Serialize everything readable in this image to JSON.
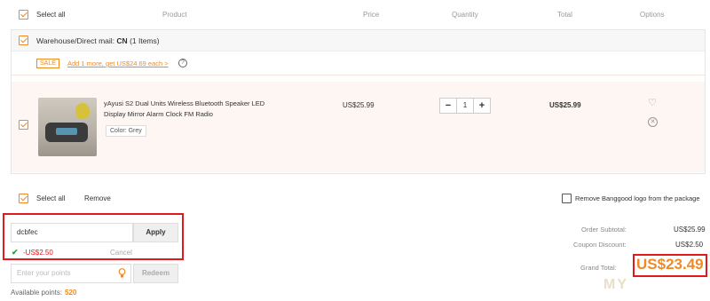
{
  "header": {
    "select_all": "Select all",
    "product": "Product",
    "price": "Price",
    "quantity": "Quantity",
    "total": "Total",
    "options": "Options"
  },
  "group": {
    "warehouse_label": "Warehouse/Direct mail:",
    "warehouse_code": "CN",
    "items_count": "(1 Items)",
    "sale_badge": "SALE",
    "promo_text": "Add 1 more, get US$24.69 each >",
    "help_icon": "?"
  },
  "item": {
    "title": "yAyusi S2 Dual Units Wireless Bluetooth Speaker LED Display Mirror Alarm Clock FM Radio",
    "color": "Color: Grey",
    "price": "US$25.99",
    "quantity": "1",
    "minus": "−",
    "plus": "+",
    "total": "US$25.99",
    "icons": {
      "wishlist": "heart-icon",
      "remove": "close-icon"
    }
  },
  "bottom_bar": {
    "select_all": "Select all",
    "remove": "Remove",
    "remove_logo": "Remove Banggood logo from the package"
  },
  "coupon": {
    "code": "dcbfec",
    "apply": "Apply",
    "applied_amount": "-US$2.50",
    "cancel": "Cancel"
  },
  "points": {
    "placeholder": "Enter your points",
    "redeem": "Redeem",
    "available_label": "Available points:",
    "available_value": "520"
  },
  "summary": {
    "subtotal_label": "Order Subtotal:",
    "subtotal_value": "US$25.99",
    "coupon_label": "Coupon Discount:",
    "coupon_value": "US$2.50",
    "grand_label": "Grand Total:",
    "grand_value": "US$23.49"
  },
  "watermark": "MY",
  "colors": {
    "accent": "#f08a24",
    "highlight_frame": "#e0191e",
    "success": "#2c9e3a"
  }
}
